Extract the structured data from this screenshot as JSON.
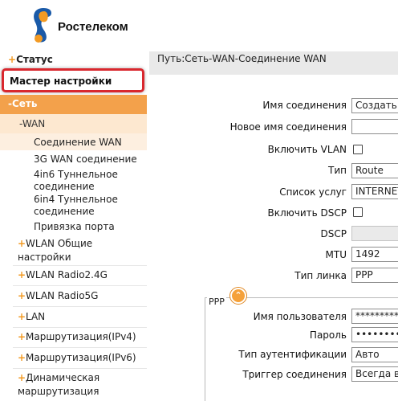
{
  "brand": {
    "name": "Ростелеком"
  },
  "sidebar": {
    "status": "Статус",
    "wizard": "Мастер настройки",
    "network": "-Сеть",
    "wan": "-WAN",
    "wan_items": [
      "Соединение WAN",
      "3G WAN соединение",
      "4in6 Туннельное",
      "соединение",
      "6in4 Туннельное",
      "соединение",
      "Привязка порта"
    ],
    "groups": [
      {
        "label": "WLAN Общие",
        "label2": "настройки"
      },
      {
        "label": "WLAN Radio2.4G"
      },
      {
        "label": "WLAN Radio5G"
      },
      {
        "label": "LAN"
      },
      {
        "label": "Маршрутизация(IPv4)"
      },
      {
        "label": "Маршрутизация(IPv6)"
      },
      {
        "label": "Динамическая",
        "label2": "маршрутизация"
      }
    ]
  },
  "main": {
    "path": "Путь:Сеть-WAN-Соединение WAN",
    "fields": {
      "conn_name_label": "Имя соединения",
      "conn_name_value": "Создать",
      "new_name_label": "Новое имя соединения",
      "new_name_value": "",
      "vlan_label": "Включить VLAN",
      "type_label": "Тип",
      "type_value": "Route",
      "services_label": "Список услуг",
      "services_value": "INTERNET",
      "dscp_enable_label": "Включить DSCP",
      "dscp_label": "DSCP",
      "dscp_value": "",
      "mtu_label": "MTU",
      "mtu_value": "1492",
      "link_type_label": "Тип линка",
      "link_type_value": "PPP"
    },
    "ppp": {
      "title": "PPP",
      "toggle_glyph": "⌃",
      "username_label": "Имя пользователя",
      "username_value": "**********",
      "password_label": "Пароль",
      "password_value": "••••••••••",
      "auth_label": "Тип аутентификации",
      "auth_value": "Авто",
      "trigger_label": "Триггер соединения",
      "trigger_value": "Всегда вкл"
    }
  },
  "colors": {
    "accent": "#f29a23",
    "menu_active": "#f3a14b",
    "submenu": "#fde8d0",
    "highlight": "#d9272e"
  }
}
